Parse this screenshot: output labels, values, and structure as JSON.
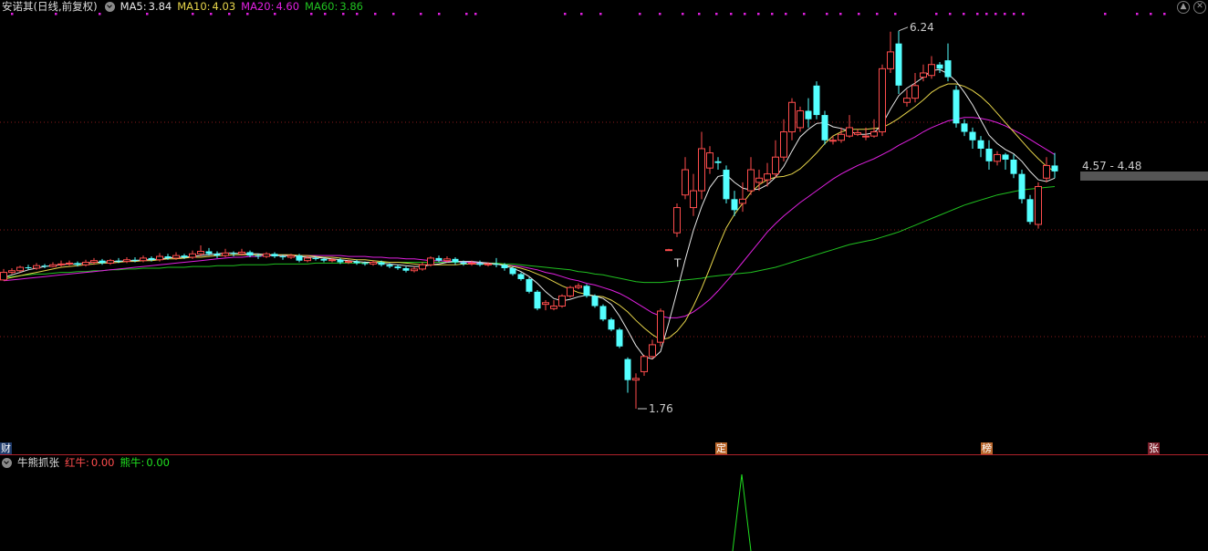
{
  "header": {
    "stock_title": "安诺其(日线,前复权)",
    "ma5_label": "MA5:",
    "ma5_value": "3.84",
    "ma10_label": "MA10:",
    "ma10_value": "4.03",
    "ma20_label": "MA20:",
    "ma20_value": "4.60",
    "ma60_label": "MA60:",
    "ma60_value": "3.86"
  },
  "colors": {
    "up": "#ff4d4d",
    "down": "#54ffff",
    "ma5": "#e8e8e8",
    "ma10": "#e6d44a",
    "ma20": "#e020e0",
    "ma60": "#20c020",
    "marker": "#e020e0",
    "grid": "#8a1a1a"
  },
  "annotations": {
    "high": "6.24",
    "low": "1.76",
    "range": "4.57 - 4.48",
    "t_marker": "T"
  },
  "badges": {
    "left": "财",
    "ding": "定",
    "bang": "榜",
    "zhang": "张"
  },
  "indicator": {
    "name": "牛熊抓张",
    "red_label": "红牛:",
    "red_value": "0.00",
    "bear_label": "熊牛:",
    "bear_value": "0.00"
  },
  "window_buttons": {
    "up": "▲",
    "close": "✕"
  },
  "chart_data": {
    "type": "candlestick",
    "ylim": [
      1.5,
      6.4
    ],
    "candles": [
      [
        3.29,
        3.38,
        3.42,
        3.28
      ],
      [
        3.38,
        3.4,
        3.43,
        3.36
      ],
      [
        3.4,
        3.44,
        3.46,
        3.38
      ],
      [
        3.44,
        3.43,
        3.47,
        3.41
      ],
      [
        3.43,
        3.46,
        3.49,
        3.41
      ],
      [
        3.46,
        3.45,
        3.48,
        3.43
      ],
      [
        3.45,
        3.47,
        3.5,
        3.44
      ],
      [
        3.47,
        3.48,
        3.52,
        3.45
      ],
      [
        3.48,
        3.49,
        3.52,
        3.46
      ],
      [
        3.49,
        3.47,
        3.51,
        3.45
      ],
      [
        3.47,
        3.5,
        3.53,
        3.45
      ],
      [
        3.5,
        3.52,
        3.55,
        3.47
      ],
      [
        3.52,
        3.49,
        3.54,
        3.47
      ],
      [
        3.49,
        3.52,
        3.54,
        3.47
      ],
      [
        3.52,
        3.51,
        3.55,
        3.49
      ],
      [
        3.51,
        3.53,
        3.56,
        3.49
      ],
      [
        3.53,
        3.52,
        3.56,
        3.5
      ],
      [
        3.52,
        3.55,
        3.58,
        3.5
      ],
      [
        3.55,
        3.53,
        3.57,
        3.51
      ],
      [
        3.53,
        3.57,
        3.61,
        3.51
      ],
      [
        3.57,
        3.55,
        3.6,
        3.53
      ],
      [
        3.55,
        3.58,
        3.62,
        3.53
      ],
      [
        3.58,
        3.56,
        3.6,
        3.54
      ],
      [
        3.56,
        3.6,
        3.64,
        3.54
      ],
      [
        3.6,
        3.63,
        3.7,
        3.57
      ],
      [
        3.63,
        3.6,
        3.67,
        3.58
      ],
      [
        3.6,
        3.58,
        3.63,
        3.55
      ],
      [
        3.58,
        3.61,
        3.66,
        3.56
      ],
      [
        3.61,
        3.6,
        3.63,
        3.57
      ],
      [
        3.6,
        3.62,
        3.66,
        3.58
      ],
      [
        3.62,
        3.58,
        3.64,
        3.56
      ],
      [
        3.58,
        3.57,
        3.6,
        3.54
      ],
      [
        3.57,
        3.6,
        3.62,
        3.55
      ],
      [
        3.6,
        3.57,
        3.62,
        3.55
      ],
      [
        3.57,
        3.56,
        3.59,
        3.53
      ],
      [
        3.56,
        3.58,
        3.6,
        3.54
      ],
      [
        3.58,
        3.52,
        3.6,
        3.5
      ],
      [
        3.52,
        3.55,
        3.58,
        3.5
      ],
      [
        3.55,
        3.54,
        3.57,
        3.52
      ],
      [
        3.54,
        3.52,
        3.56,
        3.5
      ],
      [
        3.52,
        3.53,
        3.55,
        3.5
      ],
      [
        3.53,
        3.5,
        3.55,
        3.48
      ],
      [
        3.5,
        3.51,
        3.53,
        3.48
      ],
      [
        3.51,
        3.49,
        3.53,
        3.47
      ],
      [
        3.49,
        3.48,
        3.51,
        3.46
      ],
      [
        3.48,
        3.5,
        3.52,
        3.46
      ],
      [
        3.5,
        3.47,
        3.52,
        3.45
      ],
      [
        3.47,
        3.45,
        3.49,
        3.43
      ],
      [
        3.45,
        3.43,
        3.47,
        3.41
      ],
      [
        3.43,
        3.4,
        3.45,
        3.38
      ],
      [
        3.4,
        3.42,
        3.45,
        3.38
      ],
      [
        3.42,
        3.47,
        3.5,
        3.4
      ],
      [
        3.47,
        3.55,
        3.57,
        3.45
      ],
      [
        3.55,
        3.52,
        3.58,
        3.5
      ],
      [
        3.52,
        3.54,
        3.57,
        3.5
      ],
      [
        3.54,
        3.5,
        3.56,
        3.47
      ],
      [
        3.5,
        3.48,
        3.52,
        3.46
      ],
      [
        3.48,
        3.49,
        3.52,
        3.46
      ],
      [
        3.49,
        3.47,
        3.52,
        3.45
      ],
      [
        3.47,
        3.48,
        3.5,
        3.45
      ],
      [
        3.48,
        3.47,
        3.55,
        3.44
      ],
      [
        3.47,
        3.43,
        3.49,
        3.4
      ],
      [
        3.43,
        3.36,
        3.45,
        3.34
      ],
      [
        3.36,
        3.3,
        3.38,
        3.28
      ],
      [
        3.3,
        3.15,
        3.32,
        3.13
      ],
      [
        3.15,
        2.95,
        3.17,
        2.93
      ],
      [
        3.0,
        3.02,
        3.05,
        2.93
      ],
      [
        2.95,
        2.98,
        3.05,
        2.93
      ],
      [
        2.98,
        3.1,
        3.12,
        2.96
      ],
      [
        3.1,
        3.2,
        3.22,
        3.08
      ],
      [
        3.2,
        3.22,
        3.25,
        3.18
      ],
      [
        3.22,
        3.1,
        3.24,
        3.08
      ],
      [
        3.1,
        2.98,
        3.12,
        2.96
      ],
      [
        2.98,
        2.82,
        3.0,
        2.8
      ],
      [
        2.82,
        2.7,
        2.84,
        2.68
      ],
      [
        2.7,
        2.5,
        2.72,
        2.48
      ],
      [
        2.35,
        2.1,
        2.37,
        1.95
      ],
      [
        2.1,
        2.12,
        2.18,
        1.76
      ],
      [
        2.2,
        2.38,
        2.4,
        2.15
      ],
      [
        2.38,
        2.52,
        2.58,
        2.35
      ],
      [
        2.55,
        2.92,
        2.95,
        2.5
      ],
      [
        3.65,
        3.65,
        3.66,
        3.64
      ],
      [
        3.85,
        4.15,
        4.2,
        3.8
      ],
      [
        4.3,
        4.6,
        4.75,
        4.25
      ],
      [
        4.15,
        4.35,
        4.55,
        4.05
      ],
      [
        4.35,
        4.85,
        5.05,
        4.25
      ],
      [
        4.62,
        4.8,
        4.88,
        4.55
      ],
      [
        4.7,
        4.68,
        4.75,
        4.6
      ],
      [
        4.6,
        4.25,
        4.65,
        4.2
      ],
      [
        4.25,
        4.12,
        4.35,
        4.05
      ],
      [
        4.2,
        4.25,
        4.45,
        4.1
      ],
      [
        4.35,
        4.6,
        4.75,
        4.3
      ],
      [
        4.45,
        4.5,
        4.6,
        4.35
      ],
      [
        4.48,
        4.55,
        4.68,
        4.4
      ],
      [
        4.55,
        4.75,
        4.95,
        4.5
      ],
      [
        4.75,
        5.05,
        5.2,
        4.7
      ],
      [
        5.05,
        5.4,
        5.45,
        4.95
      ],
      [
        5.1,
        5.3,
        5.35,
        5.05
      ],
      [
        5.3,
        5.2,
        5.45,
        5.1
      ],
      [
        5.6,
        5.25,
        5.65,
        5.2
      ],
      [
        5.25,
        4.95,
        5.3,
        4.9
      ],
      [
        4.95,
        4.95,
        5.0,
        4.9
      ],
      [
        4.95,
        5.02,
        5.1,
        4.92
      ],
      [
        5.0,
        5.1,
        5.25,
        4.98
      ],
      [
        5.02,
        5.04,
        5.08,
        5.0
      ],
      [
        5.0,
        5.0,
        5.1,
        4.95
      ],
      [
        5.0,
        5.05,
        5.2,
        4.98
      ],
      [
        5.05,
        5.8,
        5.85,
        5.0
      ],
      [
        5.8,
        6.0,
        6.24,
        5.75
      ],
      [
        6.1,
        5.6,
        6.25,
        5.5
      ],
      [
        5.4,
        5.45,
        5.55,
        5.35
      ],
      [
        5.45,
        5.6,
        5.75,
        5.4
      ],
      [
        5.7,
        5.75,
        5.85,
        5.65
      ],
      [
        5.72,
        5.85,
        5.95,
        5.68
      ],
      [
        5.85,
        5.8,
        5.88,
        5.75
      ],
      [
        5.9,
        5.7,
        6.1,
        5.65
      ],
      [
        5.55,
        5.15,
        5.6,
        5.1
      ],
      [
        5.15,
        5.05,
        5.2,
        5.0
      ],
      [
        5.05,
        4.95,
        5.1,
        4.85
      ],
      [
        4.95,
        4.85,
        5.0,
        4.75
      ],
      [
        4.85,
        4.7,
        4.95,
        4.6
      ],
      [
        4.7,
        4.78,
        4.82,
        4.65
      ],
      [
        4.78,
        4.72,
        4.8,
        4.6
      ],
      [
        4.72,
        4.55,
        4.78,
        4.5
      ],
      [
        4.55,
        4.25,
        4.6,
        4.2
      ],
      [
        4.25,
        3.98,
        4.3,
        3.95
      ],
      [
        3.95,
        4.4,
        4.45,
        3.9
      ],
      [
        4.5,
        4.65,
        4.75,
        4.45
      ],
      [
        4.65,
        4.58,
        4.8,
        4.5
      ]
    ],
    "ma5": [
      3.32,
      3.35,
      3.38,
      3.41,
      3.43,
      3.45,
      3.46,
      3.47,
      3.48,
      3.48,
      3.49,
      3.5,
      3.5,
      3.51,
      3.51,
      3.52,
      3.52,
      3.53,
      3.53,
      3.54,
      3.55,
      3.56,
      3.56,
      3.57,
      3.58,
      3.59,
      3.6,
      3.61,
      3.61,
      3.6,
      3.6,
      3.6,
      3.59,
      3.58,
      3.58,
      3.58,
      3.57,
      3.56,
      3.56,
      3.55,
      3.54,
      3.53,
      3.52,
      3.51,
      3.5,
      3.5,
      3.49,
      3.48,
      3.47,
      3.46,
      3.45,
      3.45,
      3.47,
      3.48,
      3.5,
      3.51,
      3.51,
      3.51,
      3.5,
      3.49,
      3.48,
      3.46,
      3.43,
      3.39,
      3.33,
      3.25,
      3.15,
      3.07,
      3.04,
      3.06,
      3.09,
      3.11,
      3.1,
      3.07,
      3.0,
      2.86,
      2.69,
      2.51,
      2.38,
      2.35,
      2.44,
      2.78,
      3.15,
      3.53,
      3.88,
      4.16,
      4.39,
      4.52,
      4.54,
      4.45,
      4.38,
      4.36,
      4.37,
      4.42,
      4.51,
      4.64,
      4.82,
      4.99,
      5.08,
      5.15,
      5.16,
      5.11,
      5.09,
      5.06,
      5.02,
      5.02,
      5.04,
      5.14,
      5.32,
      5.48,
      5.57,
      5.63,
      5.7,
      5.78,
      5.79,
      5.74,
      5.65,
      5.52,
      5.37,
      5.19,
      5.01,
      4.91,
      4.84,
      4.79,
      4.7,
      4.58,
      4.48,
      4.46,
      4.5
    ],
    "ma10": [
      3.3,
      3.32,
      3.34,
      3.36,
      3.38,
      3.4,
      3.42,
      3.44,
      3.45,
      3.46,
      3.47,
      3.48,
      3.49,
      3.49,
      3.5,
      3.51,
      3.51,
      3.52,
      3.52,
      3.53,
      3.54,
      3.54,
      3.55,
      3.56,
      3.56,
      3.57,
      3.58,
      3.58,
      3.59,
      3.59,
      3.59,
      3.59,
      3.59,
      3.59,
      3.59,
      3.59,
      3.58,
      3.58,
      3.57,
      3.56,
      3.56,
      3.55,
      3.54,
      3.53,
      3.53,
      3.52,
      3.51,
      3.5,
      3.5,
      3.49,
      3.48,
      3.47,
      3.47,
      3.47,
      3.47,
      3.47,
      3.48,
      3.48,
      3.48,
      3.48,
      3.48,
      3.47,
      3.45,
      3.43,
      3.4,
      3.36,
      3.32,
      3.27,
      3.22,
      3.18,
      3.14,
      3.12,
      3.1,
      3.09,
      3.05,
      2.99,
      2.91,
      2.81,
      2.72,
      2.64,
      2.58,
      2.6,
      2.68,
      2.8,
      2.98,
      3.19,
      3.43,
      3.68,
      3.91,
      4.07,
      4.2,
      4.33,
      4.42,
      4.48,
      4.51,
      4.52,
      4.55,
      4.61,
      4.7,
      4.8,
      4.91,
      5.0,
      5.05,
      5.08,
      5.08,
      5.08,
      5.09,
      5.1,
      5.15,
      5.21,
      5.28,
      5.35,
      5.43,
      5.52,
      5.58,
      5.62,
      5.62,
      5.59,
      5.54,
      5.47,
      5.38,
      5.27,
      5.16,
      5.05,
      4.94,
      4.83,
      4.73,
      4.64,
      4.58
    ],
    "ma20": [
      3.28,
      3.29,
      3.3,
      3.31,
      3.32,
      3.33,
      3.34,
      3.35,
      3.36,
      3.37,
      3.38,
      3.39,
      3.4,
      3.41,
      3.42,
      3.43,
      3.44,
      3.45,
      3.46,
      3.47,
      3.48,
      3.49,
      3.5,
      3.51,
      3.52,
      3.53,
      3.54,
      3.55,
      3.56,
      3.56,
      3.57,
      3.57,
      3.58,
      3.58,
      3.58,
      3.58,
      3.58,
      3.58,
      3.58,
      3.58,
      3.58,
      3.58,
      3.57,
      3.57,
      3.57,
      3.56,
      3.56,
      3.55,
      3.55,
      3.54,
      3.54,
      3.53,
      3.52,
      3.52,
      3.51,
      3.51,
      3.5,
      3.5,
      3.49,
      3.49,
      3.48,
      3.47,
      3.46,
      3.45,
      3.43,
      3.41,
      3.38,
      3.36,
      3.33,
      3.3,
      3.28,
      3.25,
      3.23,
      3.2,
      3.17,
      3.13,
      3.08,
      3.02,
      2.96,
      2.9,
      2.86,
      2.84,
      2.84,
      2.86,
      2.91,
      2.98,
      3.06,
      3.16,
      3.27,
      3.38,
      3.5,
      3.62,
      3.74,
      3.86,
      3.96,
      4.05,
      4.13,
      4.21,
      4.28,
      4.35,
      4.42,
      4.49,
      4.55,
      4.6,
      4.65,
      4.69,
      4.73,
      4.78,
      4.83,
      4.89,
      4.94,
      4.99,
      5.05,
      5.1,
      5.14,
      5.18,
      5.2,
      5.22,
      5.22,
      5.21,
      5.19,
      5.16,
      5.12,
      5.07,
      5.02,
      4.96,
      4.9,
      4.84,
      4.78
    ],
    "ma60": [
      3.32,
      3.33,
      3.34,
      3.35,
      3.36,
      3.36,
      3.37,
      3.38,
      3.38,
      3.39,
      3.39,
      3.4,
      3.4,
      3.41,
      3.41,
      3.42,
      3.42,
      3.43,
      3.43,
      3.43,
      3.44,
      3.44,
      3.44,
      3.45,
      3.45,
      3.45,
      3.46,
      3.46,
      3.46,
      3.47,
      3.47,
      3.47,
      3.47,
      3.48,
      3.48,
      3.48,
      3.48,
      3.48,
      3.49,
      3.49,
      3.49,
      3.49,
      3.49,
      3.49,
      3.49,
      3.5,
      3.5,
      3.5,
      3.5,
      3.5,
      3.5,
      3.5,
      3.5,
      3.5,
      3.5,
      3.5,
      3.5,
      3.5,
      3.49,
      3.49,
      3.49,
      3.48,
      3.48,
      3.47,
      3.46,
      3.45,
      3.44,
      3.43,
      3.42,
      3.41,
      3.39,
      3.38,
      3.36,
      3.35,
      3.33,
      3.31,
      3.29,
      3.27,
      3.26,
      3.26,
      3.26,
      3.27,
      3.28,
      3.29,
      3.3,
      3.31,
      3.33,
      3.34,
      3.35,
      3.36,
      3.37,
      3.38,
      3.4,
      3.42,
      3.44,
      3.47,
      3.5,
      3.53,
      3.56,
      3.59,
      3.62,
      3.65,
      3.68,
      3.71,
      3.73,
      3.75,
      3.77,
      3.8,
      3.83,
      3.86,
      3.9,
      3.94,
      3.98,
      4.02,
      4.06,
      4.1,
      4.14,
      4.18,
      4.21,
      4.24,
      4.27,
      4.3,
      4.32,
      4.34,
      4.36,
      4.37,
      4.38,
      4.39,
      4.4
    ]
  }
}
